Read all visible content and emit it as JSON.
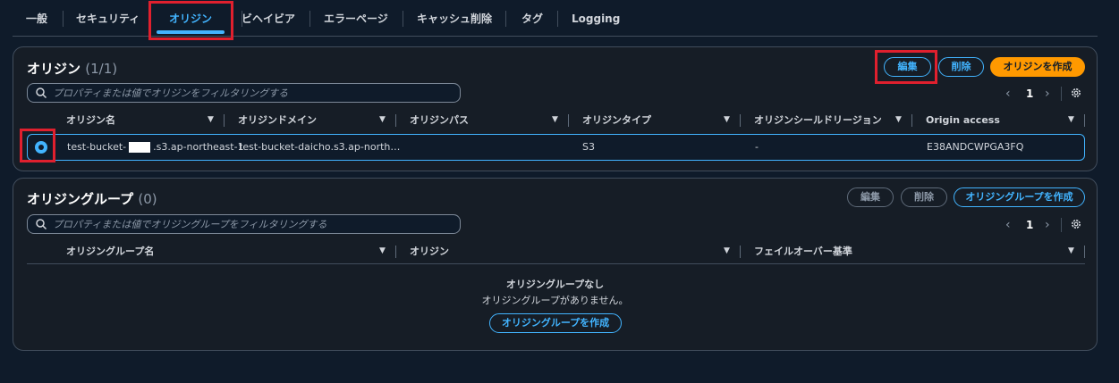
{
  "tabs": [
    "一般",
    "セキュリティ",
    "オリジン",
    "ビヘイビア",
    "エラーページ",
    "キャッシュ削除",
    "タグ",
    "Logging"
  ],
  "active_tab": "オリジン",
  "origins": {
    "title": "オリジン",
    "count": "(1/1)",
    "edit_label": "編集",
    "delete_label": "削除",
    "create_label": "オリジンを作成",
    "search_placeholder": "プロパティまたは値でオリジンをフィルタリングする",
    "page": "1",
    "columns": [
      "オリジン名",
      "オリジンドメイン",
      "オリジンパス",
      "オリジンタイプ",
      "オリジンシールドリージョン",
      "Origin access"
    ],
    "row": {
      "name_prefix": "test-bucket-",
      "name_suffix": ".s3.ap-northeast-1",
      "domain": "test-bucket-daicho.s3.ap-north…",
      "path": "",
      "type": "S3",
      "shield_region": "-",
      "access": "E38ANDCWPGA3FQ"
    }
  },
  "origin_groups": {
    "title": "オリジングループ",
    "count": "(0)",
    "edit_label": "編集",
    "delete_label": "削除",
    "create_label": "オリジングループを作成",
    "search_placeholder": "プロパティまたは値でオリジングループをフィルタリングする",
    "page": "1",
    "columns": [
      "オリジングループ名",
      "オリジン",
      "フェイルオーバー基準"
    ],
    "empty_title": "オリジングループなし",
    "empty_message": "オリジングループがありません。",
    "empty_create_label": "オリジングループを作成"
  },
  "colors": {
    "background": "#0f1b2a",
    "panel": "#161d26",
    "accent": "#42b4ff",
    "primary": "#ff9900",
    "highlight": "#e0202e"
  },
  "icons": [
    "search-icon",
    "gear-icon",
    "chevron-left-icon",
    "chevron-right-icon",
    "caret-down-icon"
  ]
}
